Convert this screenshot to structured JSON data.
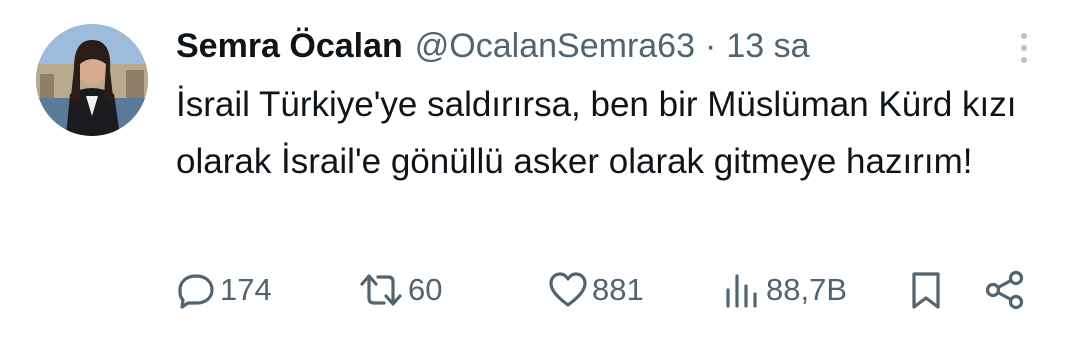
{
  "tweet": {
    "author_name": "Semra Öcalan",
    "handle": "@OcalanSemra63",
    "separator": "·",
    "time": "13 sa",
    "text": "İsrail Türkiye'ye saldırırsa, ben bir Müslüman Kürd kızı olarak İsrail'e gönüllü asker olarak gitmeye hazırım!"
  },
  "actions": {
    "replies": "174",
    "retweets": "60",
    "likes": "881",
    "views": "88,7B"
  },
  "icons": {
    "more": "more-vertical-icon",
    "reply": "reply-icon",
    "retweet": "retweet-icon",
    "like": "heart-icon",
    "views": "views-bar-chart-icon",
    "bookmark": "bookmark-icon",
    "share": "share-icon"
  },
  "colors": {
    "text_primary": "#0f1419",
    "text_secondary": "#536471",
    "background": "#ffffff"
  }
}
